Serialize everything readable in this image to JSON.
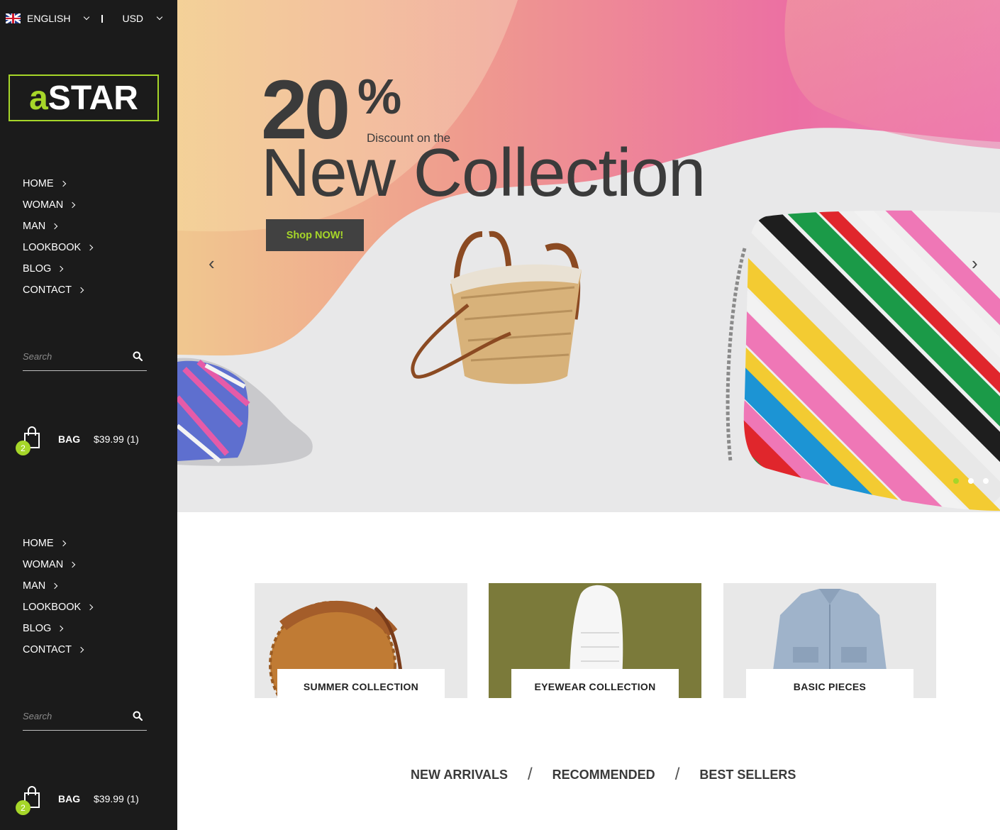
{
  "topbar": {
    "language": "ENGLISH",
    "currency": "USD",
    "language_icon": "uk-flag-icon"
  },
  "logo": {
    "accent": "a",
    "main": "STAR"
  },
  "nav": [
    {
      "label": "HOME"
    },
    {
      "label": "WOMAN"
    },
    {
      "label": "MAN"
    },
    {
      "label": "LOOKBOOK"
    },
    {
      "label": "BLOG"
    },
    {
      "label": "CONTACT"
    }
  ],
  "search": {
    "placeholder": "Search"
  },
  "bag": {
    "label": "BAG",
    "count": "2",
    "total": "$39.99 (1)"
  },
  "hero": {
    "percent": "20",
    "percent_sign": "%",
    "subline": "Discount on the",
    "headline": "New Collection",
    "cta": "Shop NOW!",
    "prev_arrow": "‹",
    "next_arrow": "›",
    "slides": 3,
    "active_slide": 1
  },
  "categories": [
    {
      "caption": "SUMMER COLLECTION"
    },
    {
      "caption": "EYEWEAR COLLECTION"
    },
    {
      "caption": "BASIC PIECES"
    }
  ],
  "tabs": [
    "NEW ARRIVALS",
    "RECOMMENDED",
    "BEST SELLERS"
  ],
  "colors": {
    "accent": "#a6d629",
    "sidebar_bg": "#1b1b1b",
    "button_bg": "#414141",
    "text_dark": "#3b3b3b"
  }
}
